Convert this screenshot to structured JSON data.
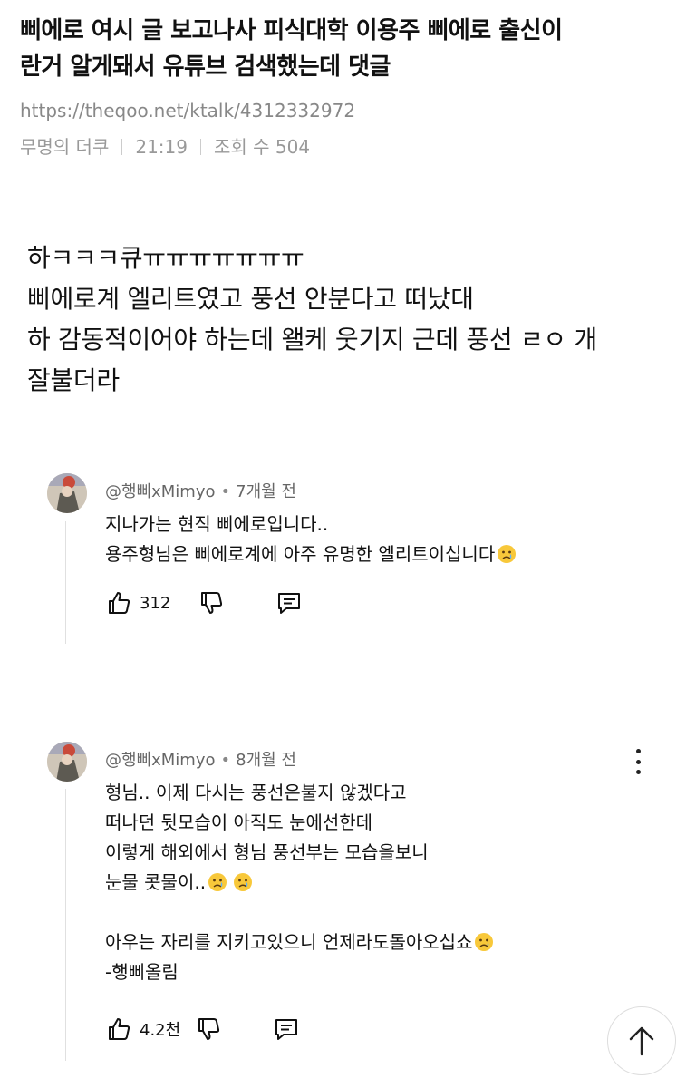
{
  "post": {
    "title_lines": [
      "삐에로 여시 글 보고나사 피식대학 이용주 삐에로 출신이",
      "란거 알게돼서 유튜브 검색했는데 댓글"
    ],
    "url": "https://theqoo.net/ktalk/4312332972",
    "author": "무명의 더쿠",
    "time": "21:19",
    "views_label": "조회 수 504",
    "body_lines": [
      "하ㅋㅋㅋ큐ㅠㅠㅠㅠㅠㅠㅠ",
      "삐에로계 엘리트였고 풍선 안분다고 떠났대",
      "하 감동적이어야 하는데 왤케 웃기지 근데 풍선 ㄹㅇ 개",
      "잘불더라"
    ]
  },
  "comments": [
    {
      "author": "@행삐xMimyo",
      "age": "7개월 전",
      "lines": [
        "지나가는 현직 삐에로입니다..",
        "용주형님은 삐에로계에 아주 유명한 엘리트이십니다"
      ],
      "likes": "312"
    },
    {
      "author": "@행삐xMimyo",
      "age": "8개월 전",
      "lines": [
        "형님..  이제 다시는 풍선은불지 않겠다고",
        "떠나던 뒷모습이 아직도 눈에선한데",
        "이렇게 해외에서 형님 풍선부는 모습을보니",
        "눈물 콧물이..",
        "",
        "아우는 자리를 지키고있으니 언제라도돌아오십쇼",
        "-행삐올림"
      ],
      "likes": "4.2천"
    }
  ],
  "icons": {
    "like": "thumbs-up-icon",
    "dislike": "thumbs-down-icon",
    "reply": "reply-icon",
    "more": "more-vertical-icon",
    "scroll_top": "arrow-up-icon",
    "emoji": "crying-face-icon"
  }
}
